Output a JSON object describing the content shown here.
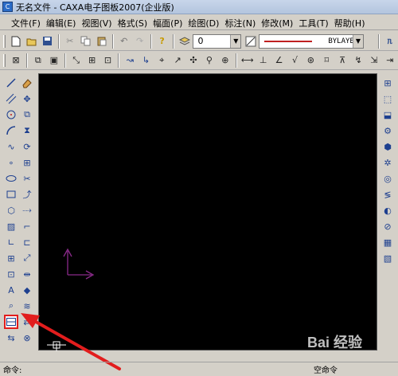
{
  "window": {
    "title": "无名文件 - CAXA电子图板2007(企业版)"
  },
  "menu": [
    {
      "label": "文件(F)"
    },
    {
      "label": "编辑(E)"
    },
    {
      "label": "视图(V)"
    },
    {
      "label": "格式(S)"
    },
    {
      "label": "幅面(P)"
    },
    {
      "label": "绘图(D)"
    },
    {
      "label": "标注(N)"
    },
    {
      "label": "修改(M)"
    },
    {
      "label": "工具(T)"
    },
    {
      "label": "帮助(H)"
    }
  ],
  "toolbar": {
    "layer_value": "0",
    "linetype_value": "BYLAYER"
  },
  "status": {
    "prompt": "命令:",
    "command": "空命令"
  },
  "colors": {
    "canvas": "#000000",
    "ucs_axis": "#8a2a8a",
    "annotation_arrow": "#e21d1d",
    "highlight_box": "#e21d1d"
  },
  "icons": {
    "left_tools": [
      "line-icon",
      "eraser-icon",
      "parallel-line-icon",
      "move-icon",
      "circle-icon",
      "copy-icon",
      "arc-icon",
      "mirror-icon",
      "spline-icon",
      "rotate-icon",
      "point-icon",
      "array-icon",
      "ellipse-icon",
      "trim-icon",
      "rectangle-icon",
      "extend-icon",
      "polygon-icon",
      "break-icon",
      "hatch-icon",
      "fillet-icon",
      "chamfer-icon",
      "stretch-icon",
      "table-icon",
      "scale-icon",
      "block-icon",
      "explode-icon",
      "text-icon",
      "fill-icon",
      "image-icon",
      "wave-icon",
      "title-block-icon",
      "symbol-icon",
      "center-line-icon",
      "hole-icon",
      "insert-icon",
      "paint-icon"
    ],
    "right_tools": [
      "library-icon",
      "cube-icon",
      "part-icon",
      "screw-icon",
      "nut-icon",
      "gear-icon",
      "bearing-icon",
      "spring-icon",
      "cam-icon",
      "weld-icon",
      "grid-icon",
      "hatch-pattern-icon"
    ]
  },
  "watermark": "Bai 经验"
}
